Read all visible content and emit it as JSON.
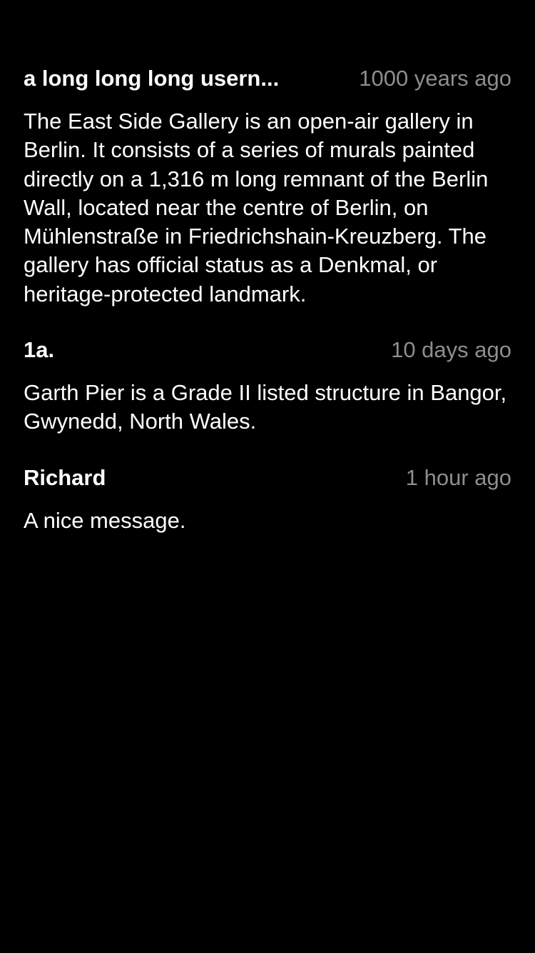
{
  "colors": {
    "background": "#000000",
    "text": "#ffffff",
    "timestamp": "#8d8d92"
  },
  "comments": [
    {
      "username": "a long long long usern...",
      "timestamp": "1000 years ago",
      "text": "The East Side Gallery is an open-air gallery in Berlin. It consists of a series of murals painted directly on a 1,316 m long remnant of the Berlin Wall, located near the centre of Berlin, on Mühlenstraße in Friedrichshain-Kreuzberg. The gallery has official status as a Denkmal, or heritage-protected landmark."
    },
    {
      "username": "1a.",
      "timestamp": "10 days ago",
      "text": "Garth Pier is a Grade II listed structure in Bangor, Gwynedd, North Wales."
    },
    {
      "username": "Richard",
      "timestamp": "1 hour ago",
      "text": "A nice message."
    }
  ]
}
